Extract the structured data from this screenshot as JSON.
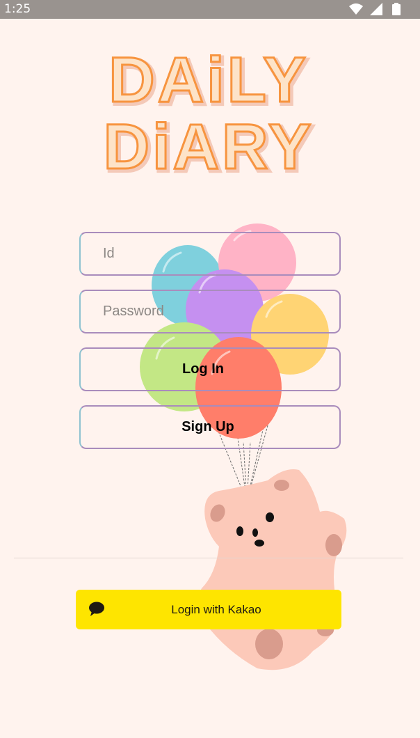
{
  "status_bar": {
    "time": "1:25"
  },
  "logo": {
    "line1": "DAiLY",
    "line2": "DiARY"
  },
  "login_form": {
    "id_placeholder": "Id",
    "password_placeholder": "Password",
    "login_label": "Log In",
    "signup_label": "Sign Up"
  },
  "social_login": {
    "kakao_label": "Login with Kakao"
  },
  "colors": {
    "background": "#fff3ee",
    "status_bar": "#99938f",
    "logo_orange": "#f7943f",
    "kakao_yellow": "#fee500",
    "field_border": "#a98cbc"
  }
}
